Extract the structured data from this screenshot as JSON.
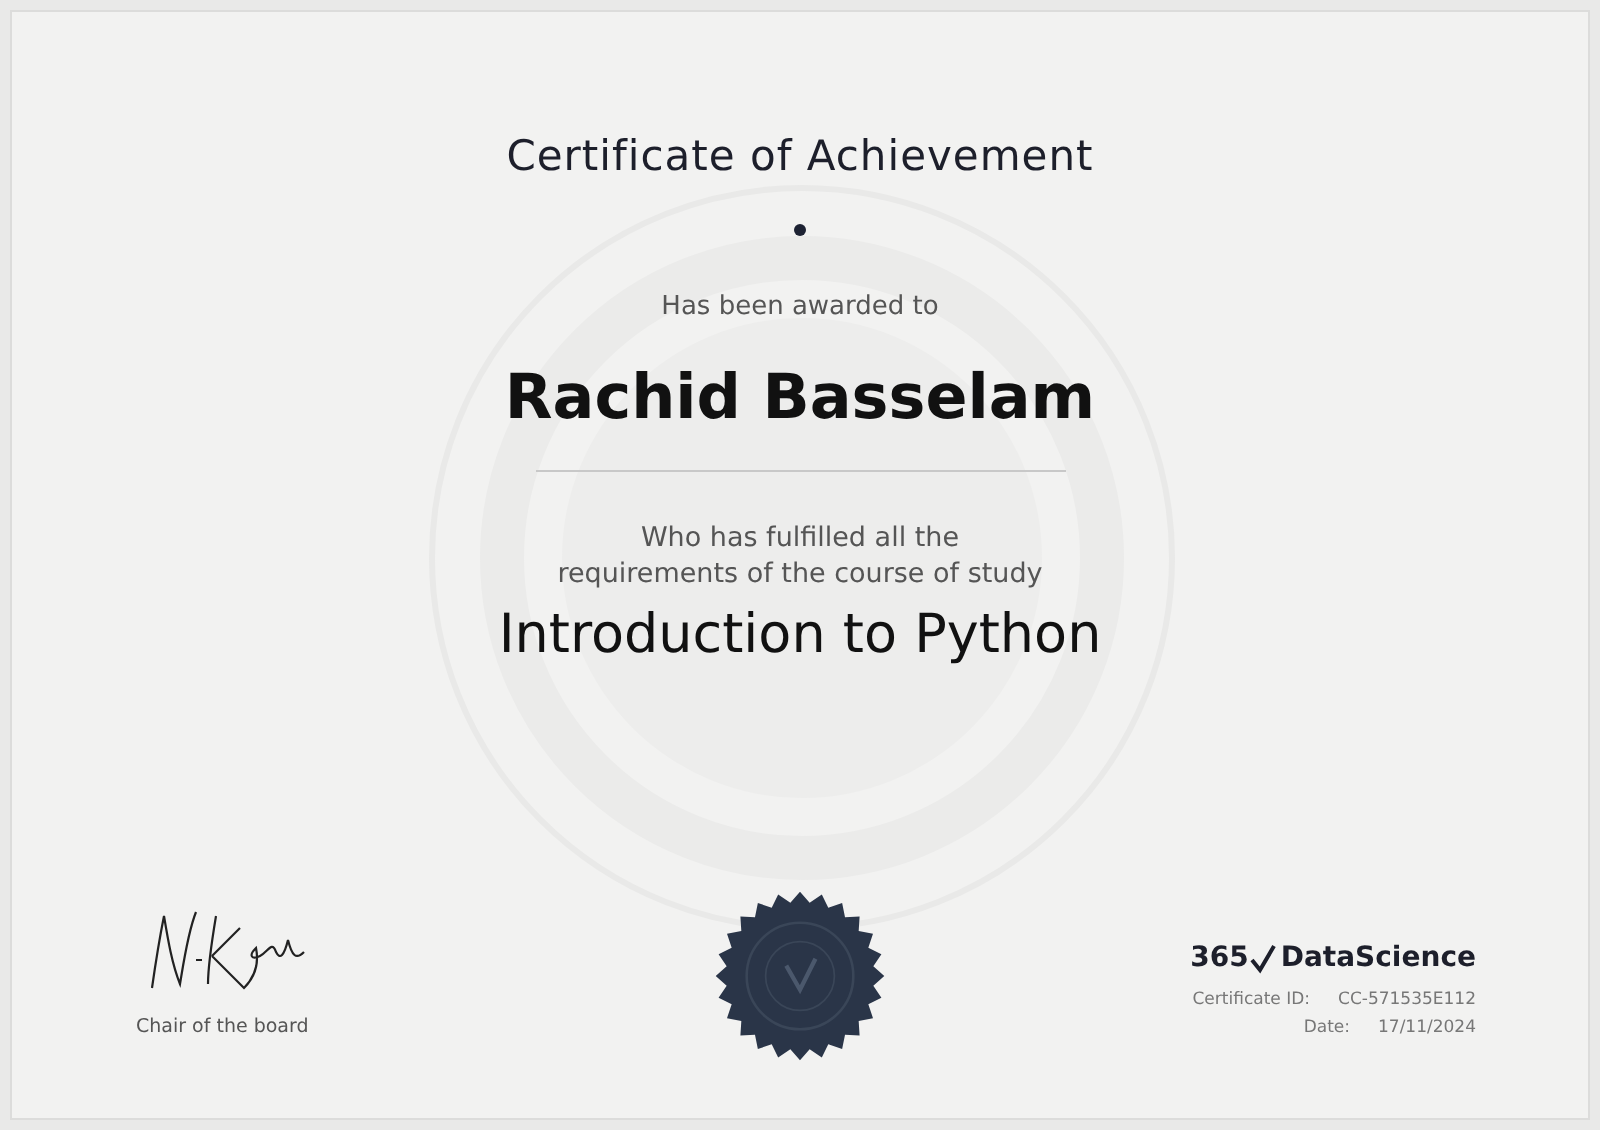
{
  "certificate": {
    "title": "Certificate of Achievement",
    "awarded_text": "Has been awarded to",
    "recipient": "Rachid Basselam",
    "fulfilled_lines": [
      "Who has fulfilled all the",
      "requirements of the course of study"
    ],
    "course": "Introduction to Python"
  },
  "signature": {
    "role": "Chair of the board"
  },
  "logo": {
    "number": "365",
    "name": "DataScience"
  },
  "details": [
    {
      "label": "Certificate ID:",
      "value": "CC-571535E112"
    },
    {
      "label": "Date:",
      "value": "17/11/2024"
    }
  ]
}
